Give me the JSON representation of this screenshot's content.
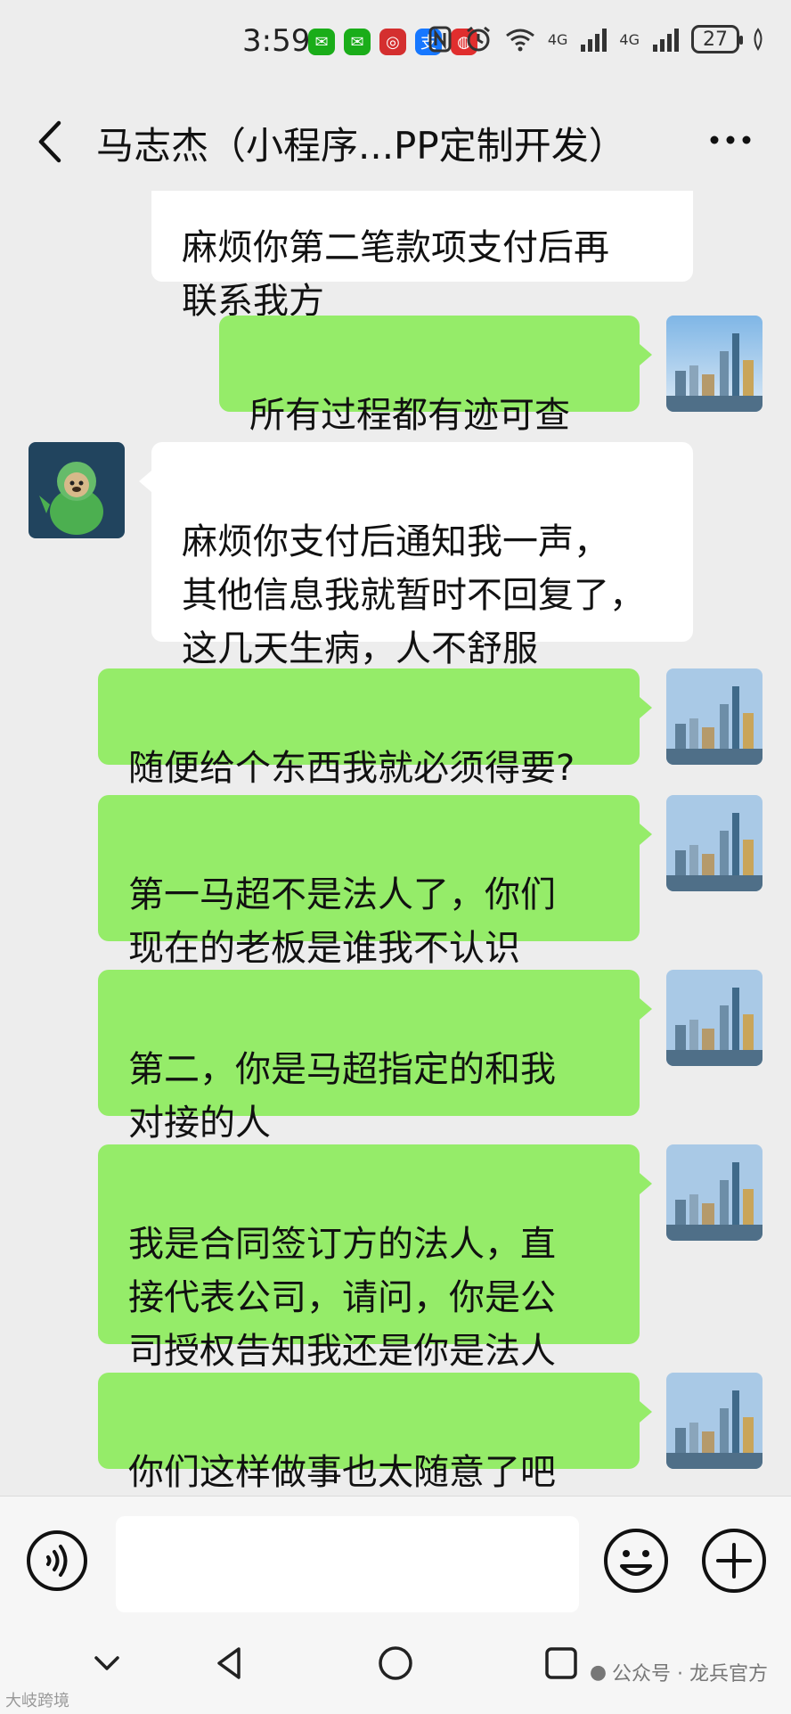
{
  "status_bar": {
    "time": "3:59",
    "battery": "27",
    "network_1": "4G",
    "network_2": "4G"
  },
  "header": {
    "title": "马志杰（小程序...PP定制开发）"
  },
  "messages": [
    {
      "side": "left",
      "text": "麻烦你第二笔款项支付后再\n联系我方",
      "partial": true
    },
    {
      "side": "right",
      "text": "所有过程都有迹可查"
    },
    {
      "side": "left",
      "text": "麻烦你支付后通知我一声，\n其他信息我就暂时不回复了，\n这几天生病，人不舒服"
    },
    {
      "side": "right",
      "text": "随便给个东西我就必须得要?"
    },
    {
      "side": "right",
      "text": "第一马超不是法人了，你们\n现在的老板是谁我不认识"
    },
    {
      "side": "right",
      "text": "第二，你是马超指定的和我\n对接的人"
    },
    {
      "side": "right",
      "text": "我是合同签订方的法人，直\n接代表公司，请问，你是公\n司授权告知我还是你是法人"
    },
    {
      "side": "right",
      "text": "你们这样做事也太随意了吧"
    }
  ],
  "input": {
    "placeholder": ""
  },
  "watermarks": {
    "right": "公众号 · 龙兵官方",
    "left": "大岐跨境"
  },
  "colors": {
    "sent_bubble": "#95ec69",
    "received_bubble": "#ffffff",
    "background": "#ededed"
  }
}
